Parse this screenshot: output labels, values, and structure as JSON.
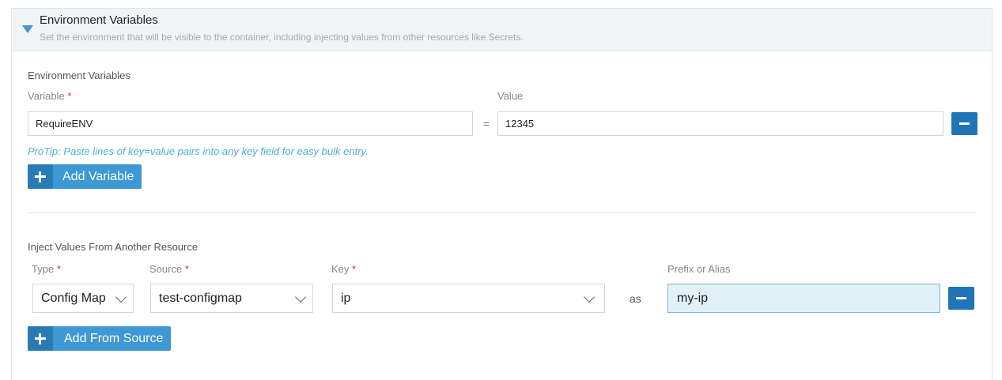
{
  "header": {
    "title": "Environment Variables",
    "description": "Set the environment that will be visible to the container, including injecting values from other resources like Secrets."
  },
  "env": {
    "section_label": "Environment Variables",
    "variable_label": "Variable",
    "value_label": "Value",
    "required_marker": "*",
    "rows": [
      {
        "variable": "RequireENV",
        "value": "12345"
      }
    ],
    "equals": "=",
    "protip": "ProTip: Paste lines of key=value pairs into any key field for easy bulk entry.",
    "add_label": "Add Variable"
  },
  "inject": {
    "section_label": "Inject Values From Another Resource",
    "type_label": "Type",
    "source_label": "Source",
    "key_label": "Key",
    "prefix_label": "Prefix or Alias",
    "required_marker": "*",
    "rows": [
      {
        "type": "Config Map",
        "source": "test-configmap",
        "key": "ip",
        "as": "as",
        "prefix": "my-ip"
      }
    ],
    "add_label": "Add From Source"
  },
  "icons": {
    "collapse": "caret-down-icon",
    "remove": "minus-icon",
    "add": "plus-icon",
    "dropdown": "chevron-down-icon"
  },
  "colors": {
    "primary": "#3d98d3",
    "primary_dark": "#1f75b7",
    "protip": "#4ab0d6",
    "required": "#e02f2f",
    "highlight_field": "#e2f1f7"
  }
}
